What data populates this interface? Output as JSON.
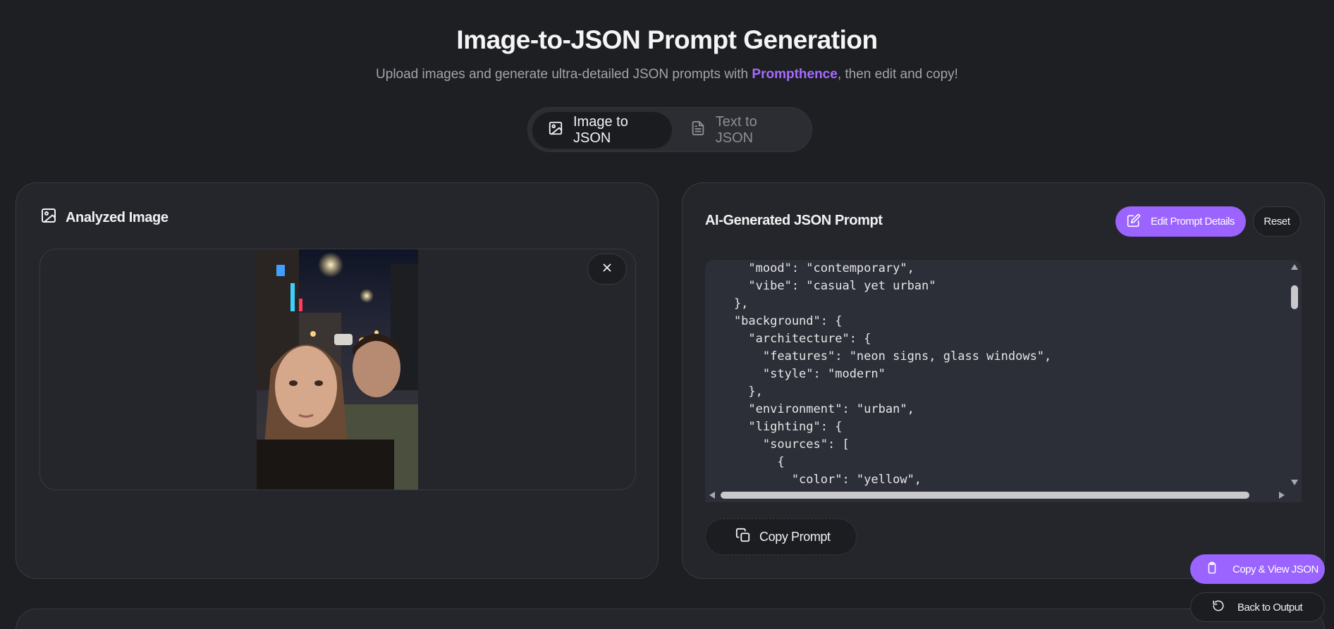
{
  "header": {
    "title": "Image-to-JSON Prompt Generation",
    "subtitle_before": "Upload images and generate ultra-detailed JSON prompts with ",
    "brand": "Prompthence",
    "subtitle_after": ", then edit and copy!"
  },
  "mode_toggle": {
    "tabs": [
      {
        "label": "Image to JSON",
        "icon": "image-icon",
        "active": true
      },
      {
        "label": "Text to JSON",
        "icon": "document-icon",
        "active": false
      }
    ]
  },
  "left_panel": {
    "heading": "Analyzed Image",
    "heading_icon": "image-icon",
    "close_icon": "close-icon"
  },
  "right_panel": {
    "heading": "AI-Generated JSON Prompt",
    "edit_label": "Edit Prompt Details",
    "reset_label": "Reset",
    "copy_label": "Copy Prompt",
    "code_lines": [
      "      \"mood\": \"contemporary\",",
      "      \"vibe\": \"casual yet urban\"",
      "    },",
      "    \"background\": {",
      "      \"architecture\": {",
      "        \"features\": \"neon signs, glass windows\",",
      "        \"style\": \"modern\"",
      "      },",
      "      \"environment\": \"urban\",",
      "      \"lighting\": {",
      "        \"sources\": [",
      "          {",
      "            \"color\": \"yellow\","
    ]
  },
  "floating": {
    "copy_view_label": "Copy & View JSON",
    "back_label": "Back to Output"
  },
  "colors": {
    "accent": "#9b63ff",
    "brand_text": "#a66bff",
    "background": "#1e1f23",
    "panel": "#25262b",
    "code_bg": "#2c2f37"
  }
}
